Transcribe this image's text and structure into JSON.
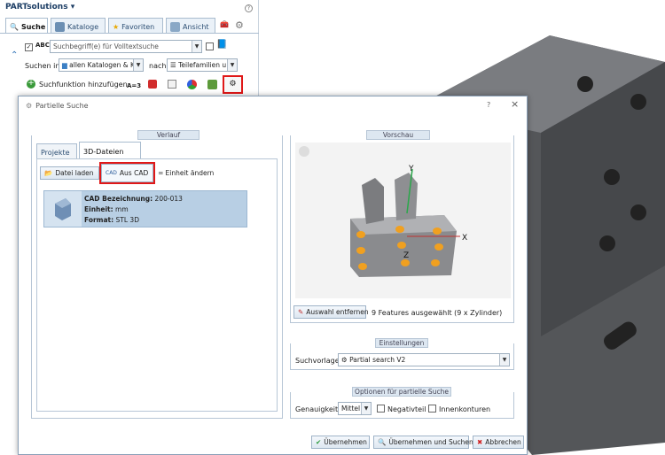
{
  "app": {
    "title": "PARTsolutions"
  },
  "tabs": [
    {
      "label": "Suche"
    },
    {
      "label": "Kataloge"
    },
    {
      "label": "Favoriten"
    },
    {
      "label": "Ansicht"
    }
  ],
  "search": {
    "placeholder": "Suchbegriff(e) für Volltextsuche",
    "abc_label": "ABC"
  },
  "search_in": {
    "label": "Suchen in",
    "catalog_value": "allen Katalogen & K",
    "nach_label": "nach",
    "family_value": "Teilefamilien u"
  },
  "add_function": {
    "label": "Suchfunktion hinzufügen:",
    "a3_label": "A=3"
  },
  "dialog": {
    "title": "Partielle Suche",
    "help": "?",
    "close": "×",
    "verlauf": {
      "title": "Verlauf",
      "tabs": [
        {
          "label": "Projekte"
        },
        {
          "label": "3D-Dateien"
        }
      ],
      "toolbar": {
        "load": "Datei laden",
        "from_cad": "Aus CAD",
        "unit": "Einheit ändern"
      },
      "item": {
        "name_label": "CAD Bezeichnung:",
        "name_value": "200-013",
        "unit_label": "Einheit:",
        "unit_value": "mm",
        "format_label": "Format:",
        "format_value": "STL 3D"
      }
    },
    "vorschau": {
      "title": "Vorschau",
      "axis_x": "X",
      "axis_y": "Y",
      "axis_z": "Z",
      "remove_button": "Auswahl entfernen",
      "status": "9 Features ausgewählt (9 x Zylinder)"
    },
    "einstellungen": {
      "title": "Einstellungen",
      "template_label": "Suchvorlage:",
      "template_value": "Partial search V2"
    },
    "optionen": {
      "title": "Optionen für partielle Suche",
      "accuracy_label": "Genauigkeit:",
      "accuracy_value": "Mittel",
      "negative": "Negativteil",
      "inner": "Innenkonturen"
    },
    "buttons": {
      "accept": "Übernehmen",
      "accept_search": "Übernehmen und Suchen",
      "cancel": "Abbrechen"
    }
  },
  "colors": {
    "accent": "#1c3d64",
    "highlight": "#e01818",
    "part_gray": "#6e6f72",
    "feature_orange": "#f0a020"
  }
}
